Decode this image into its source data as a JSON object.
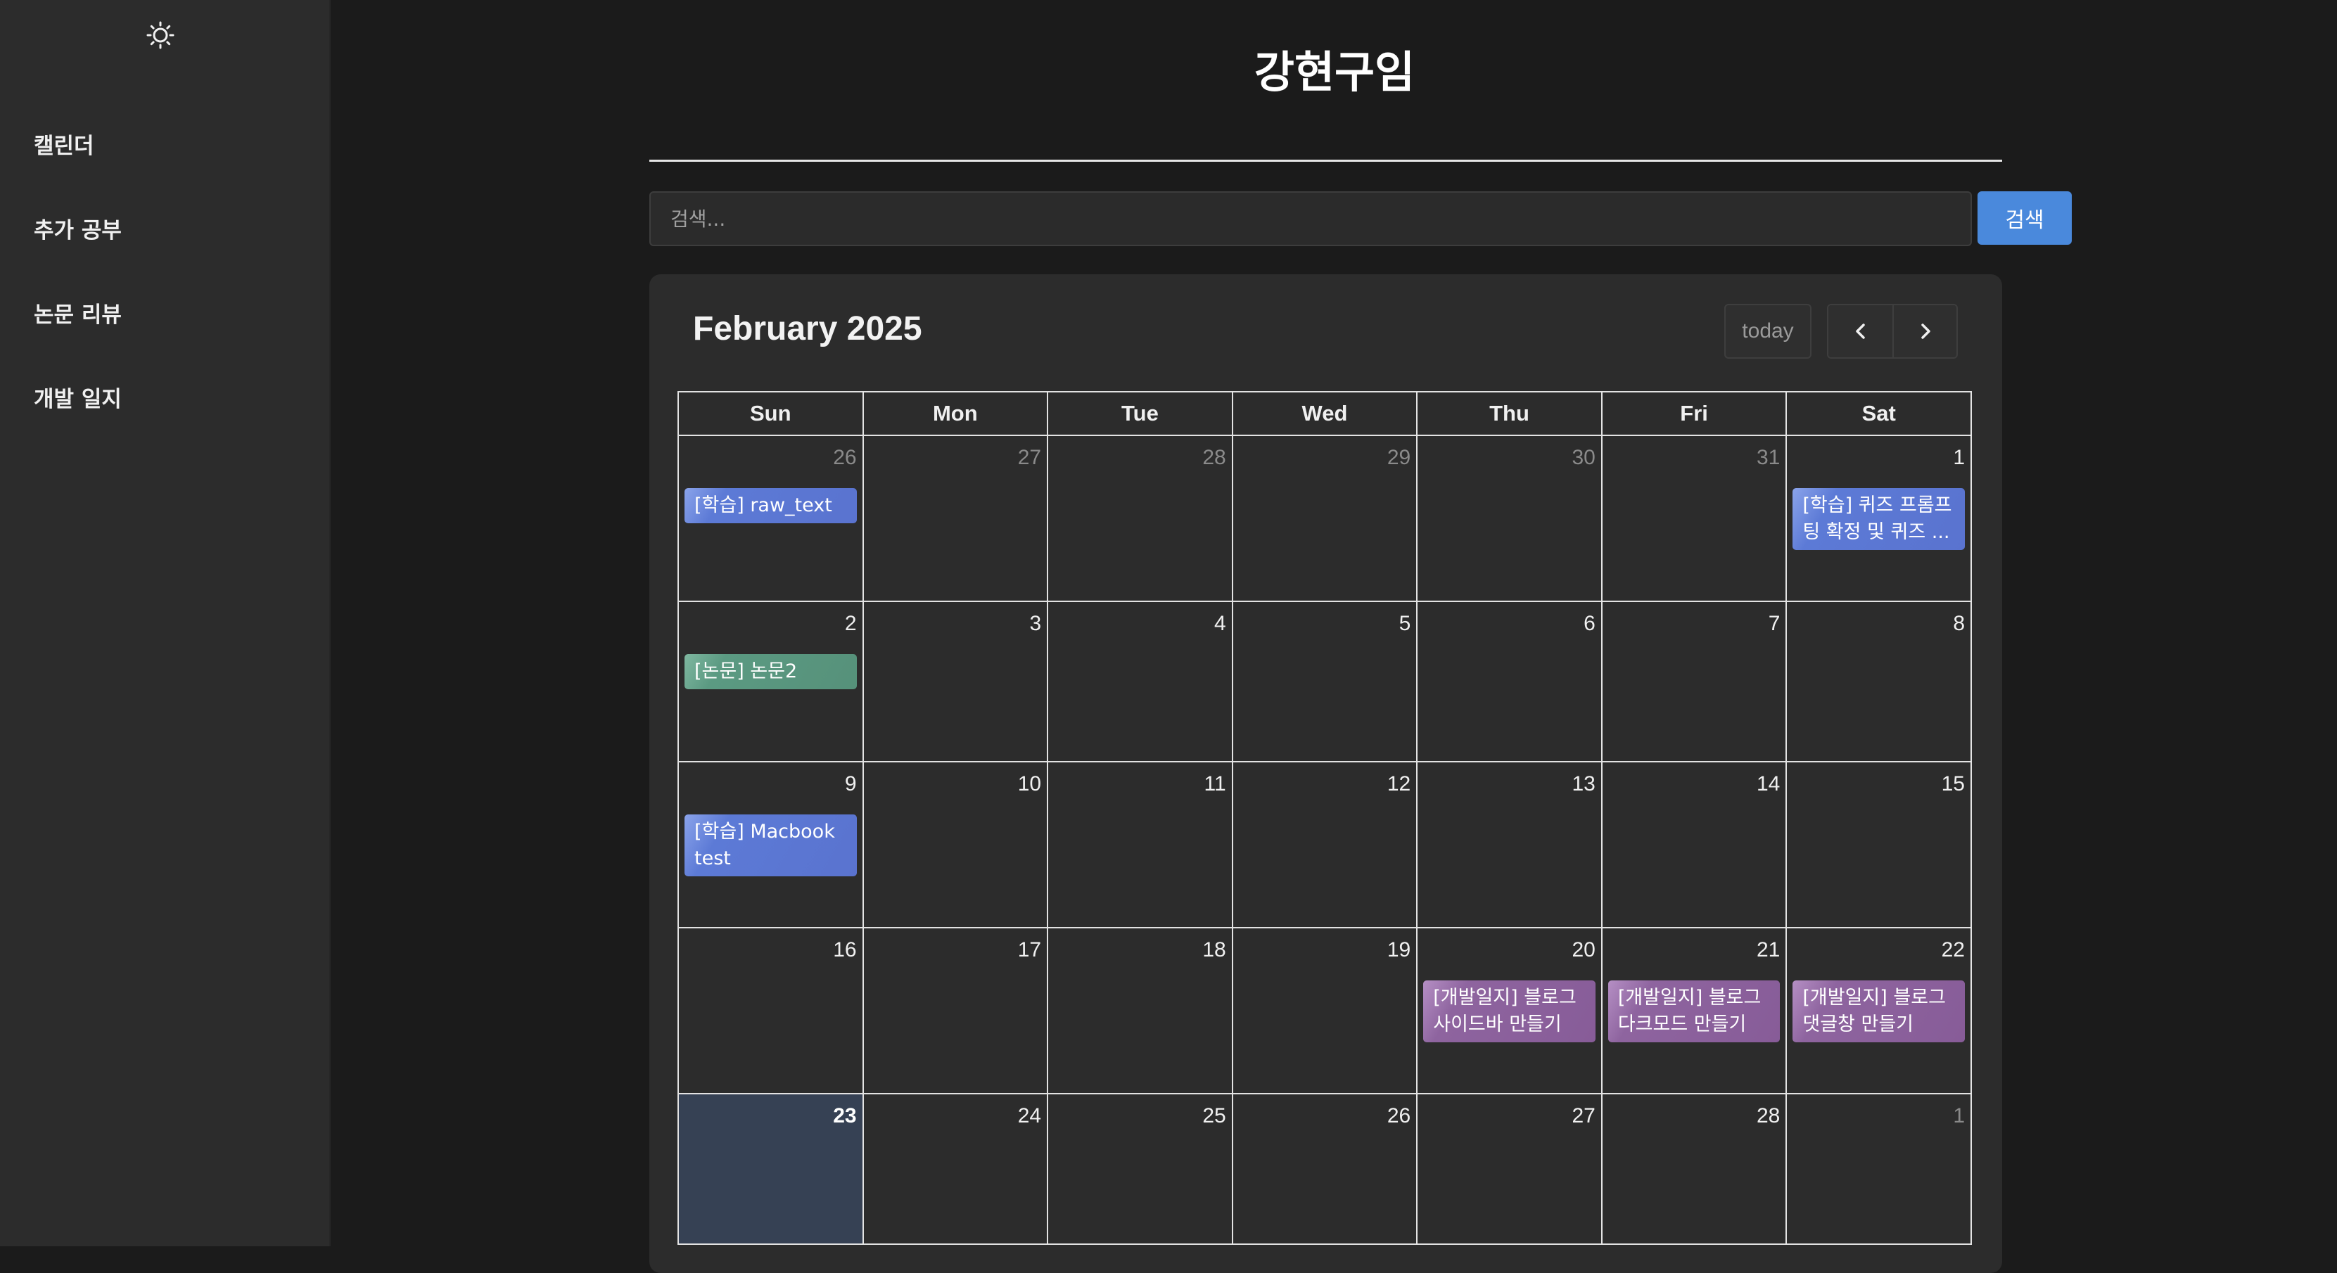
{
  "sidebar": {
    "theme_icon": "sun-icon",
    "items": [
      {
        "label": "캘린더"
      },
      {
        "label": "추가 공부"
      },
      {
        "label": "논문 리뷰"
      },
      {
        "label": "개발 일지"
      }
    ]
  },
  "header": {
    "title": "강현구임"
  },
  "search": {
    "placeholder": "검색...",
    "value": "",
    "button_label": "검색"
  },
  "calendar": {
    "title": "February 2025",
    "today_label": "today",
    "weekdays": [
      "Sun",
      "Mon",
      "Tue",
      "Wed",
      "Thu",
      "Fri",
      "Sat"
    ],
    "weeks": [
      [
        {
          "day": "26",
          "other": true,
          "event": {
            "text": "[학습] raw_text",
            "kind": "study"
          }
        },
        {
          "day": "27",
          "other": true
        },
        {
          "day": "28",
          "other": true
        },
        {
          "day": "29",
          "other": true
        },
        {
          "day": "30",
          "other": true
        },
        {
          "day": "31",
          "other": true
        },
        {
          "day": "1",
          "event": {
            "text": "[학습] 퀴즈 프롬프팅 확정 및 퀴즈 ...",
            "kind": "study"
          }
        }
      ],
      [
        {
          "day": "2",
          "event": {
            "text": "[논문] 논문2",
            "kind": "paper"
          }
        },
        {
          "day": "3"
        },
        {
          "day": "4"
        },
        {
          "day": "5"
        },
        {
          "day": "6"
        },
        {
          "day": "7"
        },
        {
          "day": "8"
        }
      ],
      [
        {
          "day": "9",
          "event": {
            "text": "[학습] Macbook test",
            "kind": "study"
          }
        },
        {
          "day": "10"
        },
        {
          "day": "11"
        },
        {
          "day": "12"
        },
        {
          "day": "13"
        },
        {
          "day": "14"
        },
        {
          "day": "15"
        }
      ],
      [
        {
          "day": "16"
        },
        {
          "day": "17"
        },
        {
          "day": "18"
        },
        {
          "day": "19"
        },
        {
          "day": "20",
          "event": {
            "text": "[개발일지] 블로그 사이드바 만들기",
            "kind": "dev"
          }
        },
        {
          "day": "21",
          "event": {
            "text": "[개발일지] 블로그 다크모드 만들기",
            "kind": "dev"
          }
        },
        {
          "day": "22",
          "event": {
            "text": "[개발일지] 블로그 댓글창 만들기",
            "kind": "dev"
          }
        }
      ],
      [
        {
          "day": "23",
          "today": true
        },
        {
          "day": "24"
        },
        {
          "day": "25"
        },
        {
          "day": "26"
        },
        {
          "day": "27"
        },
        {
          "day": "28"
        },
        {
          "day": "1",
          "other": true
        }
      ]
    ]
  },
  "colors": {
    "accent": "#4a89dc",
    "event_study": "#5a73cf",
    "event_paper": "#56917a",
    "event_dev": "#875c98",
    "today_cell": "#364154"
  }
}
